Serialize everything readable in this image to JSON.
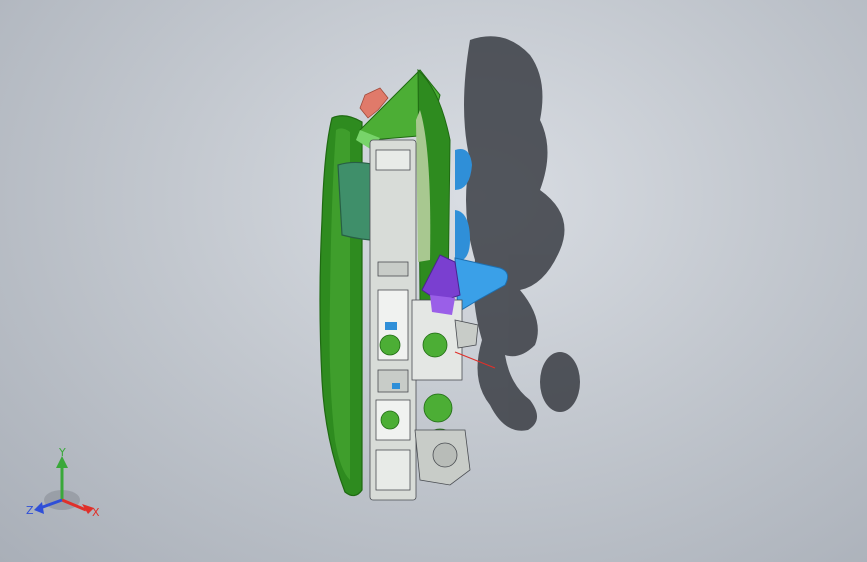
{
  "viewport": {
    "background_top": "#d9dde3",
    "background_bottom": "#a9afb8",
    "model_colors": {
      "body": "#2e8b1f",
      "body_dark": "#1f6a12",
      "body_light": "#4cae35",
      "glass": "#3f8f6a",
      "frame": "#d8dcd8",
      "accent_blue": "#2f8fd8",
      "accent_purple": "#7a3fd0",
      "shadow": "#3a3d44",
      "pink_part": "#e07a6a"
    }
  },
  "triad": {
    "x_label": "X",
    "y_label": "Y",
    "z_label": "Z",
    "x_color": "#e0302a",
    "y_color": "#3aa83a",
    "z_color": "#2f4fd8"
  }
}
